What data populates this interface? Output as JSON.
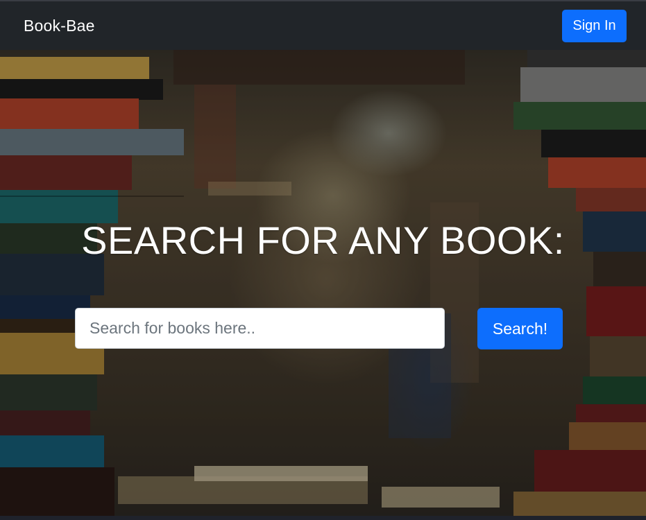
{
  "navbar": {
    "brand": "Book-Bae",
    "signin_label": "Sign In"
  },
  "hero": {
    "headline": "SEARCH FOR ANY BOOK:",
    "search_placeholder": "Search for books here..",
    "search_value": "",
    "search_button_label": "Search!"
  },
  "colors": {
    "navbar_bg": "#212529",
    "primary": "#0d6efd"
  }
}
